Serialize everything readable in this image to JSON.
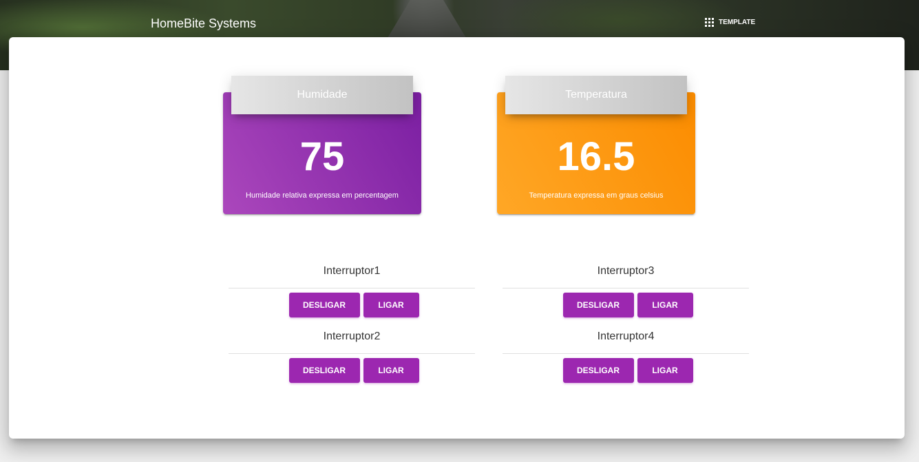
{
  "header": {
    "brand": "HomeBite Systems",
    "template_label": "TEMPLATE"
  },
  "cards": [
    {
      "title": "Humidade",
      "value": "75",
      "description": "Humidade relativa expressa em percentagem",
      "color": "#9c27b0"
    },
    {
      "title": "Temperatura",
      "value": "16.5",
      "description": "Temperatura expressa em graus celsius",
      "color": "#fb8c00"
    }
  ],
  "switches": [
    {
      "label": "Interruptor1",
      "off_label": "Desligar",
      "on_label": "Ligar"
    },
    {
      "label": "Interruptor2",
      "off_label": "Desligar",
      "on_label": "Ligar"
    },
    {
      "label": "Interruptor3",
      "off_label": "Desligar",
      "on_label": "Ligar"
    },
    {
      "label": "Interruptor4",
      "off_label": "Desligar",
      "on_label": "Ligar"
    }
  ],
  "icons": {
    "template": "apps-grid-icon"
  },
  "colors": {
    "accent": "#9c27b0",
    "orange": "#fb8c00"
  }
}
